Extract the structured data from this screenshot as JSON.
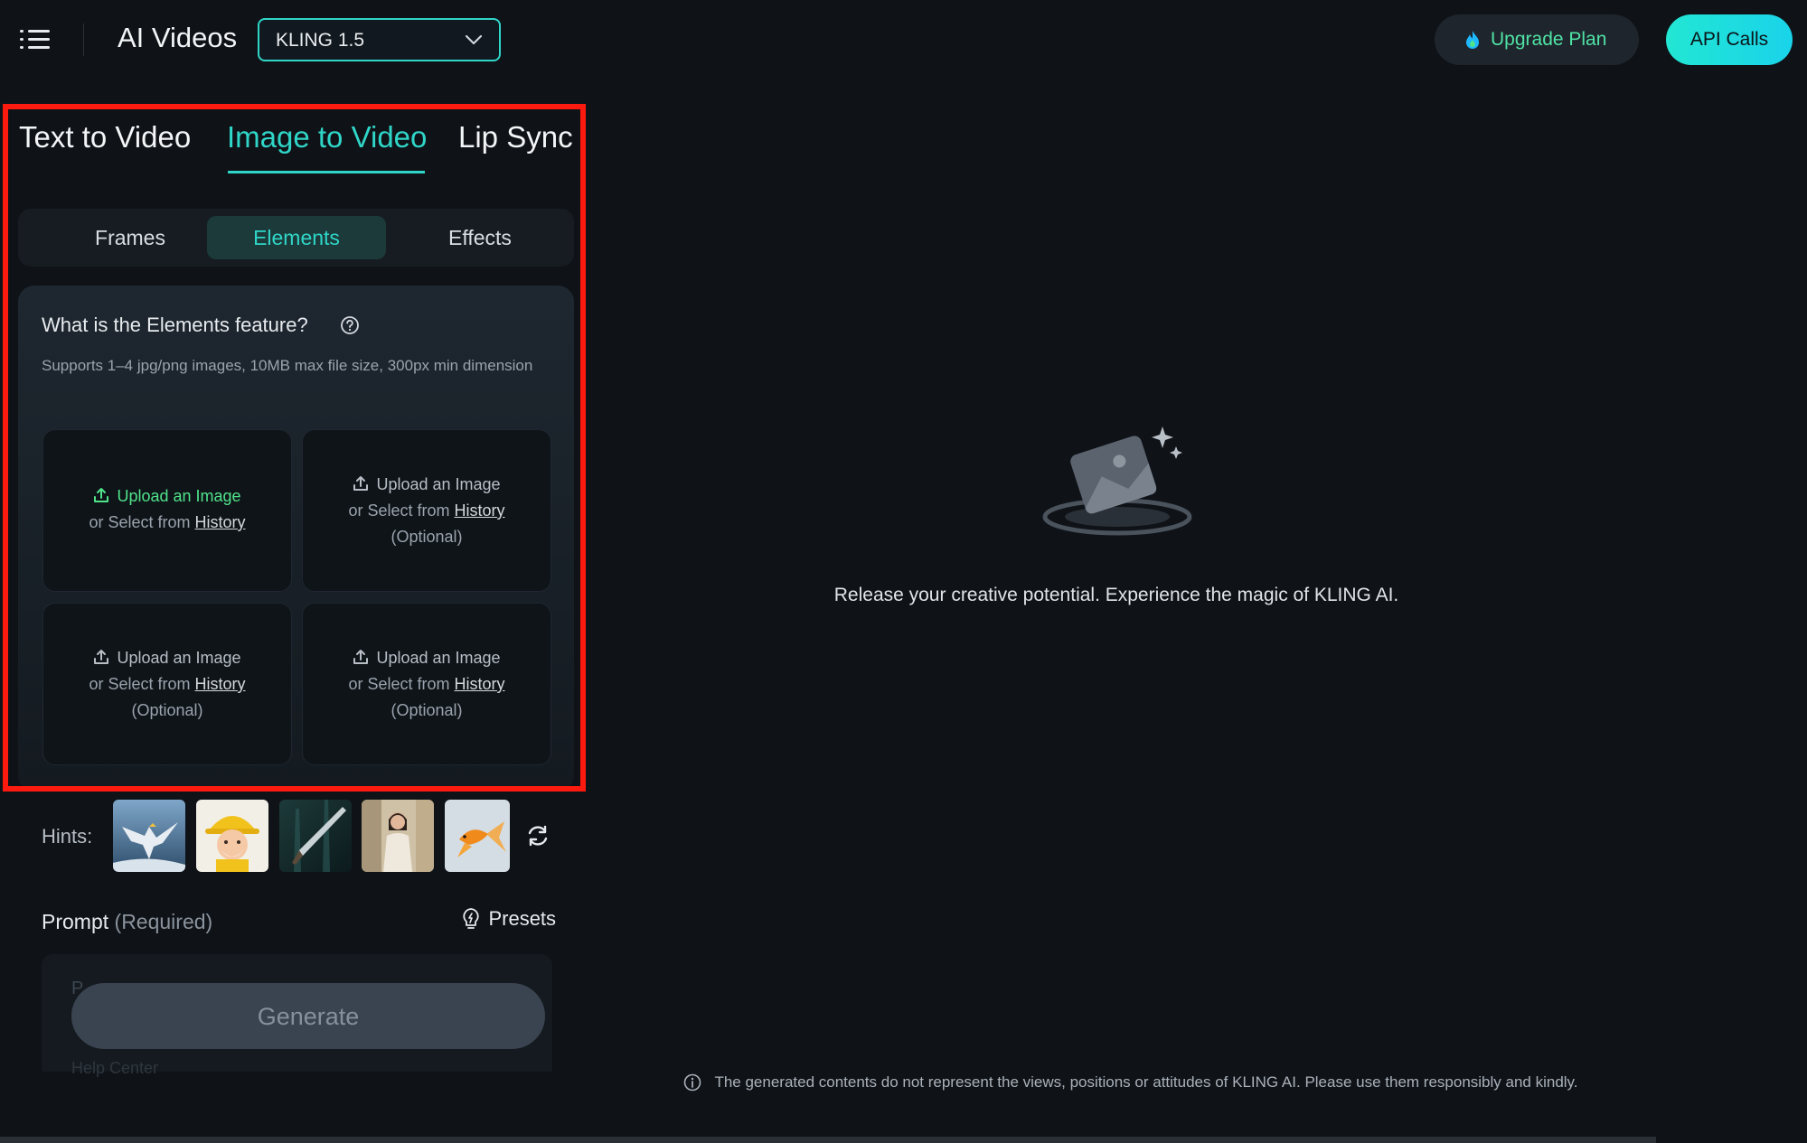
{
  "header": {
    "app_title": "AI Videos",
    "model_selected": "KLING 1.5",
    "upgrade_label": "Upgrade Plan",
    "api_label": "API Calls"
  },
  "main_tabs": [
    {
      "label": "Text to Video",
      "active": false
    },
    {
      "label": "Image to Video",
      "active": true
    },
    {
      "label": "Lip Sync",
      "active": false
    }
  ],
  "sub_tabs": [
    {
      "label": "Frames",
      "active": false
    },
    {
      "label": "Elements",
      "active": true
    },
    {
      "label": "Effects",
      "active": false
    }
  ],
  "elements": {
    "title": "What is the Elements feature?",
    "description": "Supports 1–4 jpg/png images, 10MB max file size, 300px min dimension",
    "upload_cells": [
      {
        "line1": "Upload an Image",
        "line2_prefix": "or Select from",
        "line2_link": "History",
        "line3": ""
      },
      {
        "line1": "Upload an Image",
        "line2_prefix": "or Select from",
        "line2_link": "History",
        "line3": "(Optional)"
      },
      {
        "line1": "Upload an Image",
        "line2_prefix": "or Select from",
        "line2_link": "History",
        "line3": "(Optional)"
      },
      {
        "line1": "Upload an Image",
        "line2_prefix": "or Select from",
        "line2_link": "History",
        "line3": "(Optional)"
      }
    ]
  },
  "hints": {
    "label": "Hints:",
    "thumbnails": [
      "eagle-image",
      "cartoon-farmer-image",
      "sword-image",
      "woman-portrait-image",
      "goldfish-image"
    ]
  },
  "prompt": {
    "label": "Prompt",
    "required": "(Required)",
    "presets_label": "Presets",
    "ghost_text": "P",
    "help_ghost": "Help Center"
  },
  "generate_label": "Generate",
  "hero": {
    "text": "Release your creative potential. Experience the magic of KLING AI."
  },
  "disclaimer": "The generated contents do not represent the views, positions or attitudes of KLING AI. Please use them responsibly and kindly.",
  "colors": {
    "accent": "#2fd6c8",
    "upload_accent": "#4fe38a",
    "highlight": "#ff1a0f",
    "background": "#0f1217"
  }
}
